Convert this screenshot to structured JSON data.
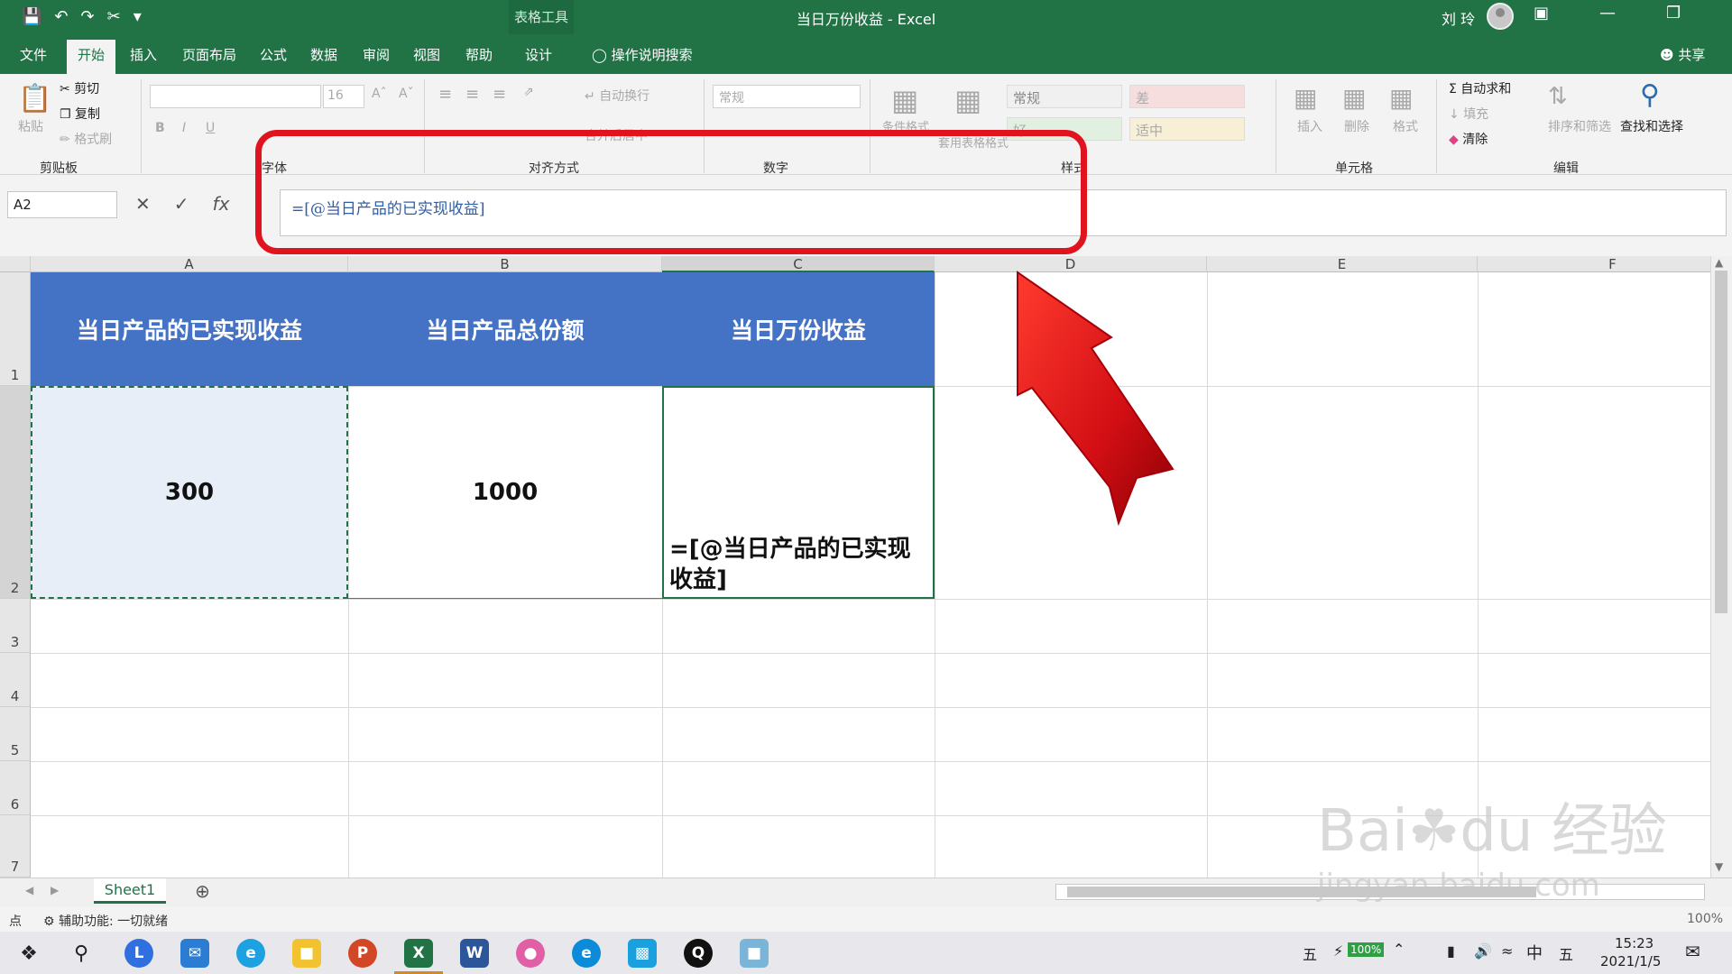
{
  "window": {
    "title": "当日万份收益 - Excel",
    "context_tools": "表格工具",
    "user": "刘 玲"
  },
  "menu": {
    "tabs": [
      "文件",
      "开始",
      "插入",
      "页面布局",
      "公式",
      "数据",
      "审阅",
      "视图",
      "帮助",
      "设计"
    ],
    "tell_me": "操作说明搜索",
    "share": "共享"
  },
  "ribbon": {
    "clipboard": {
      "paste": "粘贴",
      "cut": "剪切",
      "copy": "复制",
      "format_painter": "格式刷",
      "label": "剪贴板"
    },
    "font": {
      "size": "16",
      "bold": "B",
      "italic": "I",
      "underline": "U",
      "label": "字体"
    },
    "alignment": {
      "wrap": "自动换行",
      "merge": "合并后居中",
      "label": "对齐方式"
    },
    "number": {
      "format": "常规",
      "label": "数字"
    },
    "styles": {
      "cond_format": "条件格式",
      "table_format": "套用表格格式",
      "cells": [
        "常规",
        "差",
        "好",
        "适中"
      ],
      "label": "样式"
    },
    "cells": {
      "insert": "插入",
      "delete": "删除",
      "format": "格式",
      "label": "单元格"
    },
    "editing": {
      "autosum": "自动求和",
      "fill": "填充",
      "clear": "清除",
      "sort": "排序和筛选",
      "find": "查找和选择",
      "label": "编辑"
    }
  },
  "formula_bar": {
    "name_box": "A2",
    "formula": "=[@当日产品的已实现收益]"
  },
  "sheet": {
    "columns": [
      "A",
      "B",
      "C",
      "D",
      "E",
      "F"
    ],
    "rows": [
      "1",
      "2",
      "3",
      "4",
      "5",
      "6",
      "7"
    ],
    "headers": [
      "当日产品的已实现收益",
      "当日产品总份额",
      "当日万份收益"
    ],
    "row2": {
      "a": "300",
      "b": "1000",
      "c": "=[@当日产品的已实现收益]"
    },
    "tab": "Sheet1"
  },
  "status_bar": {
    "mode": "点",
    "accessibility": "辅助功能: 一切就绪",
    "zoom": "100%"
  },
  "taskbar": {
    "battery": "100%",
    "ime": "中",
    "ime2": "五",
    "time": "15:23",
    "date": "2021/1/5"
  },
  "colors": {
    "excel_green": "#217346",
    "table_header": "#4472c4",
    "annotation_red": "#e0141e"
  }
}
